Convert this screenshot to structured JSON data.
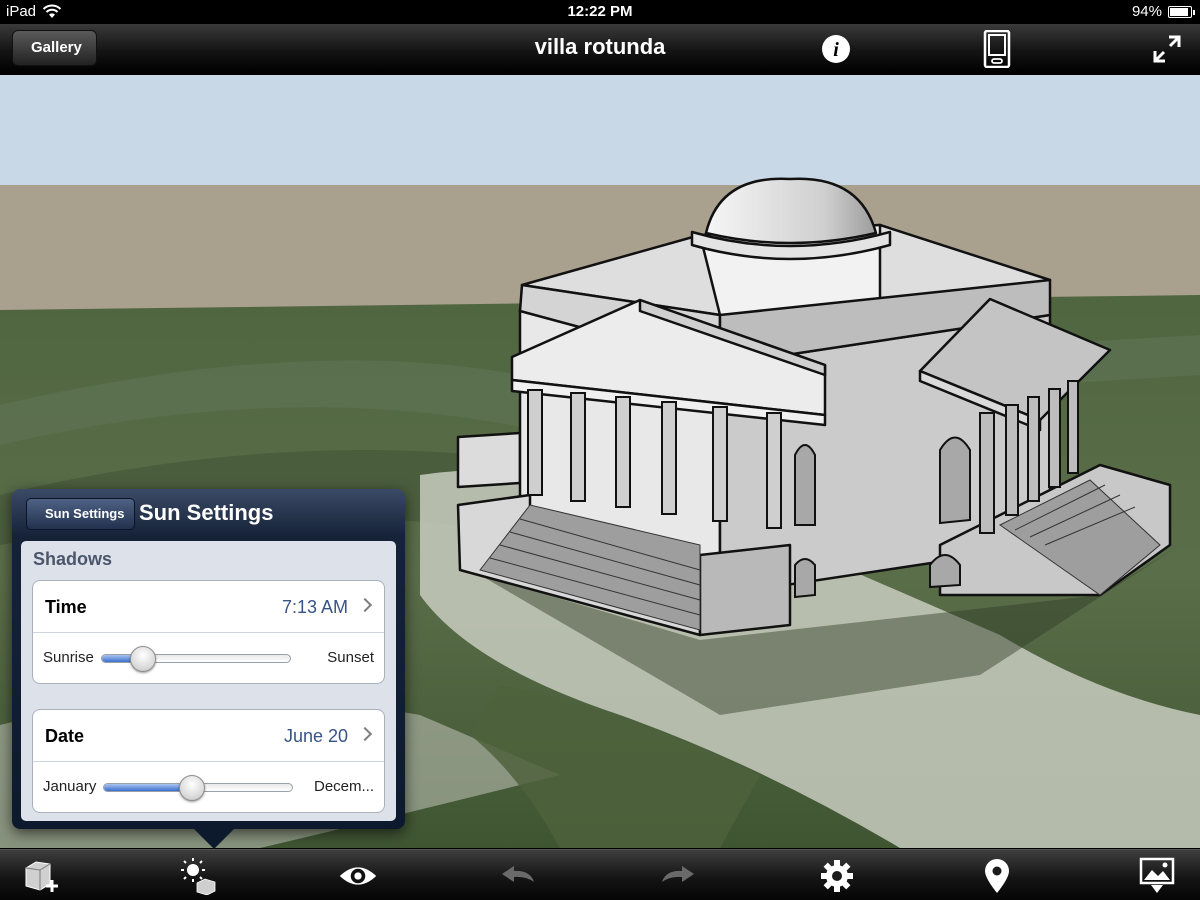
{
  "status_bar": {
    "device": "iPad",
    "time": "12:22 PM",
    "battery": "94%",
    "battery_level": 0.94
  },
  "nav": {
    "back_label": "Gallery",
    "title": "villa rotunda"
  },
  "popover": {
    "back_label": "Sun Settings",
    "title": "Sun Settings",
    "section": "Shadows",
    "time": {
      "label": "Time",
      "value": "7:13 AM",
      "min_label": "Sunrise",
      "max_label": "Sunset",
      "level": 0.22
    },
    "date": {
      "label": "Date",
      "value": "June 20",
      "min_label": "January",
      "max_label": "Decem...",
      "level": 0.47
    }
  },
  "toolbar": {
    "items": [
      "add-component-icon",
      "sun-shadows-icon",
      "view-eye-icon",
      "undo-arrow-icon",
      "redo-arrow-icon",
      "settings-gear-icon",
      "location-pin-icon",
      "export-image-icon"
    ]
  },
  "colors": {
    "popover_value": "#385487",
    "slider_fill": "#3a6fcf",
    "sky": "#c9d8e6"
  }
}
